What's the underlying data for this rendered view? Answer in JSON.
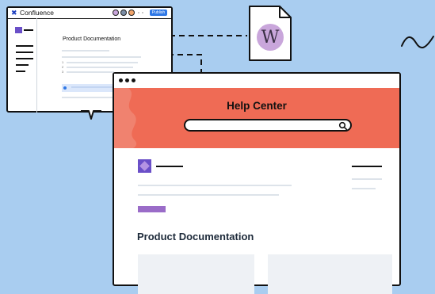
{
  "confluence_window": {
    "app_name": "Confluence",
    "publish_label": "Publish",
    "page_title": "Product Documentation",
    "list_numbers": [
      "1",
      "2",
      "3"
    ]
  },
  "help_center": {
    "title": "Help Center",
    "search": {
      "value": "",
      "placeholder": ""
    },
    "section_title": "Product Documentation"
  },
  "doc_icon": {
    "letter": "W"
  },
  "colors": {
    "background": "#a9cdf0",
    "header": "#ef6b55",
    "brand_purple": "#6a4fc8",
    "publish_blue": "#2f78e6",
    "w_circle": "#c9a6db"
  },
  "icons": [
    "confluence-logo-icon",
    "search-icon",
    "document-icon",
    "window-control-dots"
  ]
}
